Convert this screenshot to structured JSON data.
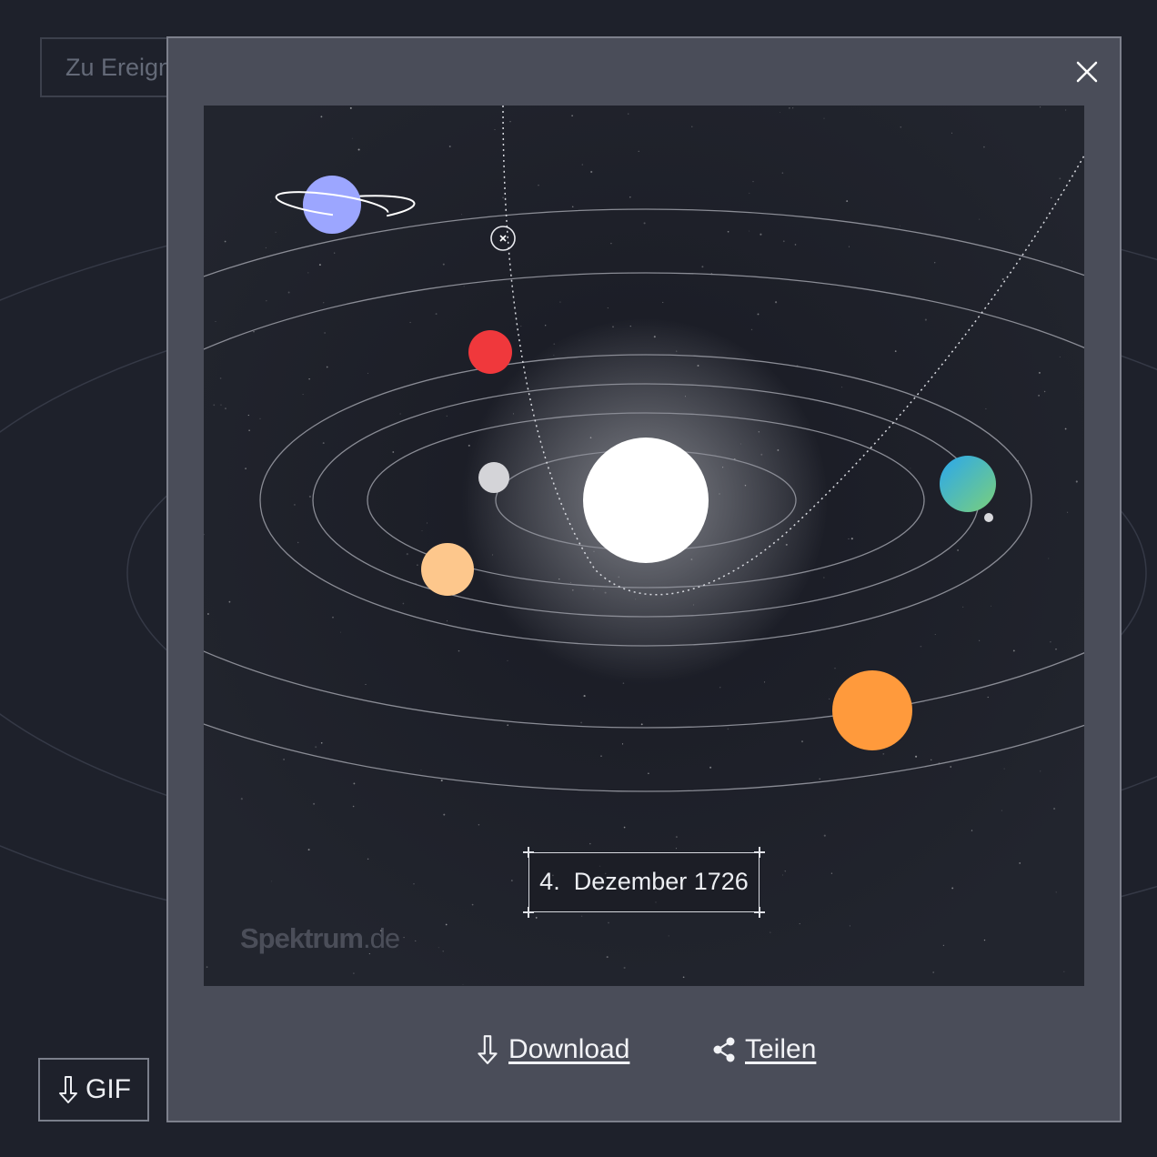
{
  "background": {
    "search_input_text": "Zu Ereignis",
    "gif_button_label": "GIF",
    "colors": {
      "page": "#1e212b",
      "orbit_lines": "#3a3e4a"
    }
  },
  "modal": {
    "close_icon": "close-icon",
    "date_label": "4.  Dezember 1726",
    "watermark": {
      "brand": "Spektrum",
      "suffix": ".de"
    },
    "actions": {
      "download_label": "Download",
      "download_icon": "download-arrow-icon",
      "share_label": "Teilen",
      "share_icon": "share-icon"
    },
    "colors": {
      "panel": "#4a4d59",
      "space": "#15171f",
      "sun": "#ffffff",
      "ringed_planet": "#9ca6ff",
      "red_planet": "#f0383c",
      "grey_planet": "#d4d4d8",
      "peach_planet": "#fdc78c",
      "blue_green_planet": "#3cb8d6",
      "orange_planet": "#ff9a3c"
    }
  }
}
